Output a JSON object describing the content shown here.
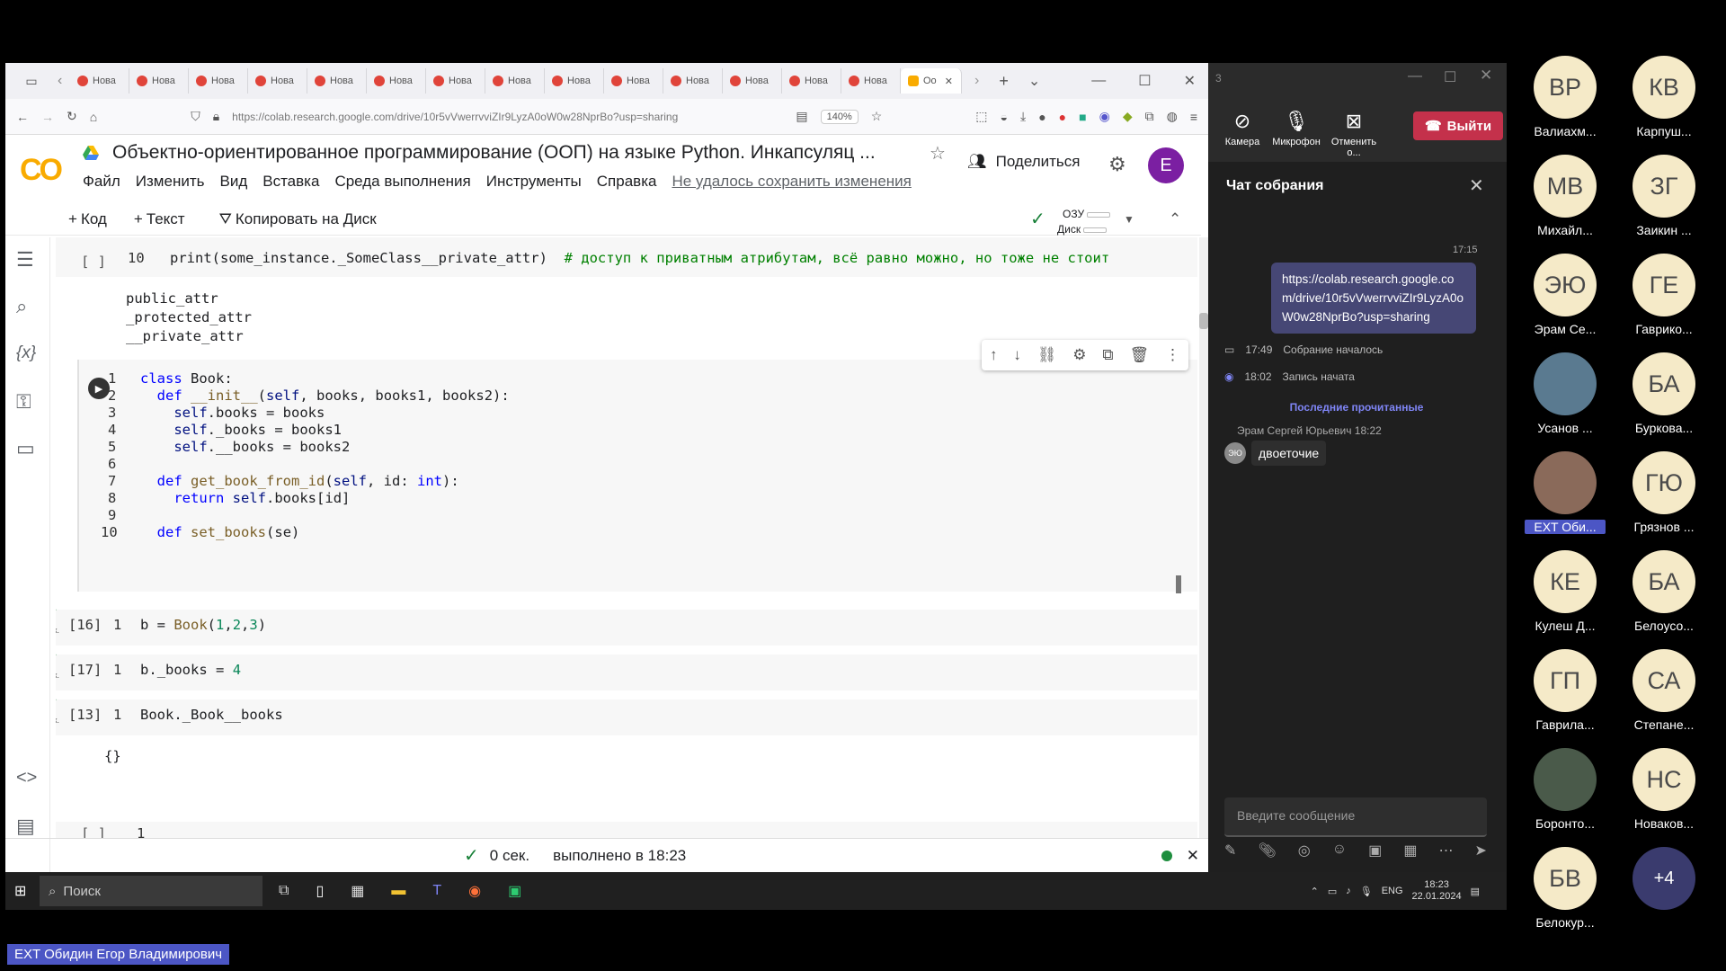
{
  "browser": {
    "tabs": [
      "Нова",
      "Нова",
      "Нова",
      "Нова",
      "Нова",
      "Нова",
      "Нова",
      "Нова",
      "Нова",
      "Нова",
      "Нова",
      "Нова",
      "Нова",
      "Нова"
    ],
    "active_tab": "Оо",
    "url": "https://colab.research.google.com/drive/10r5vVwerrvviZIr9LyzA0oW0w28NprBo?usp=sharing",
    "zoom": "140%"
  },
  "colab": {
    "logo": "CO",
    "title": "Объектно-ориентированное программирование (ООП) на языке Python. Инкапсуляц ...",
    "menu": [
      "Файл",
      "Изменить",
      "Вид",
      "Вставка",
      "Среда выполнения",
      "Инструменты",
      "Справка"
    ],
    "save_warning": "Не удалось сохранить изменения",
    "share": "Поделиться",
    "avatar": "E",
    "toolbar": {
      "code": "Код",
      "text": "Текст",
      "copy": "Копировать на Диск",
      "ram": "ОЗУ",
      "disk": "Диск"
    }
  },
  "cells": {
    "prev": {
      "prompt": "[ ]",
      "line_no": "10",
      "code": "print(some_instance._SomeClass__private_attr)",
      "comment": "# доступ к приватным атрибутам, всё равно можно, но тоже не стоит",
      "output": [
        "public_attr",
        "_protected_attr",
        "__private_attr"
      ]
    },
    "book_class": {
      "lines": [
        {
          "n": "1",
          "t": "class Book:"
        },
        {
          "n": "2",
          "t": "  def __init__(self, books, books1, books2):"
        },
        {
          "n": "3",
          "t": "    self.books = books"
        },
        {
          "n": "4",
          "t": "    self._books = books1"
        },
        {
          "n": "5",
          "t": "    self.__books = books2"
        },
        {
          "n": "6",
          "t": ""
        },
        {
          "n": "7",
          "t": "  def get_book_from_id(self, id: int):"
        },
        {
          "n": "8",
          "t": "    return self.books[id]"
        },
        {
          "n": "9",
          "t": ""
        },
        {
          "n": "10",
          "t": "  def set_books(se)"
        }
      ]
    },
    "exec": [
      {
        "prompt": "[16]",
        "n": "1",
        "code": "b = Book(1,2,3)",
        "time": "0",
        "unit": "сек."
      },
      {
        "prompt": "[17]",
        "n": "1",
        "code": "b._books = 4",
        "time": "0",
        "unit": "сек."
      },
      {
        "prompt": "[13]",
        "n": "1",
        "code": "Book._Book__books",
        "time": "0",
        "unit": "сек.",
        "output": "{}"
      }
    ],
    "empty": {
      "prompt": "[ ]",
      "n": "1"
    }
  },
  "status": {
    "time": "0 сек.",
    "done": "выполнено в 18:23"
  },
  "teams": {
    "buttons": [
      "Камера",
      "Микрофон",
      "Отменить о..."
    ],
    "leave": "Выйти",
    "chat_title": "Чат собрания",
    "msg_time": "17:15",
    "link": "https://colab.research.google.com/drive/10r5vVwerrvviZIr9LyzA0oW0w28NprBo?usp=sharing",
    "events": [
      {
        "time": "17:49",
        "text": "Собрание началось"
      },
      {
        "time": "18:02",
        "text": "Запись начата"
      }
    ],
    "last_read": "Последние прочитанные",
    "sender": "Эрам Сергей Юрьевич",
    "sender_time": "18:22",
    "sender_initials": "ЭЮ",
    "message": "двоеточие",
    "input_placeholder": "Введите сообщение"
  },
  "participants": [
    {
      "i": "ВР",
      "n": "Валиахм..."
    },
    {
      "i": "КВ",
      "n": "Карпуш..."
    },
    {
      "i": "МВ",
      "n": "Михайл..."
    },
    {
      "i": "ЗГ",
      "n": "Заикин ..."
    },
    {
      "i": "ЭЮ",
      "n": "Эрам Се..."
    },
    {
      "i": "ГЕ",
      "n": "Гаврико..."
    },
    {
      "i": "",
      "n": "Усанов ..."
    },
    {
      "i": "БА",
      "n": "Буркова..."
    },
    {
      "i": "",
      "n": "EXT Оби..."
    },
    {
      "i": "ГЮ",
      "n": "Грязнов ..."
    },
    {
      "i": "КЕ",
      "n": "Кулеш Д..."
    },
    {
      "i": "БА",
      "n": "Белоусо..."
    },
    {
      "i": "ГП",
      "n": "Гаврила..."
    },
    {
      "i": "СА",
      "n": "Степане..."
    },
    {
      "i": "",
      "n": "Боронто..."
    },
    {
      "i": "НС",
      "n": "Новаков..."
    },
    {
      "i": "БВ",
      "n": "Белокур..."
    },
    {
      "i": "+4",
      "n": ""
    }
  ],
  "taskbar": {
    "search": "Поиск",
    "lang": "ENG",
    "time": "18:23",
    "date": "22.01.2024"
  },
  "caption": "EXT Обидин Егор Владимирович"
}
